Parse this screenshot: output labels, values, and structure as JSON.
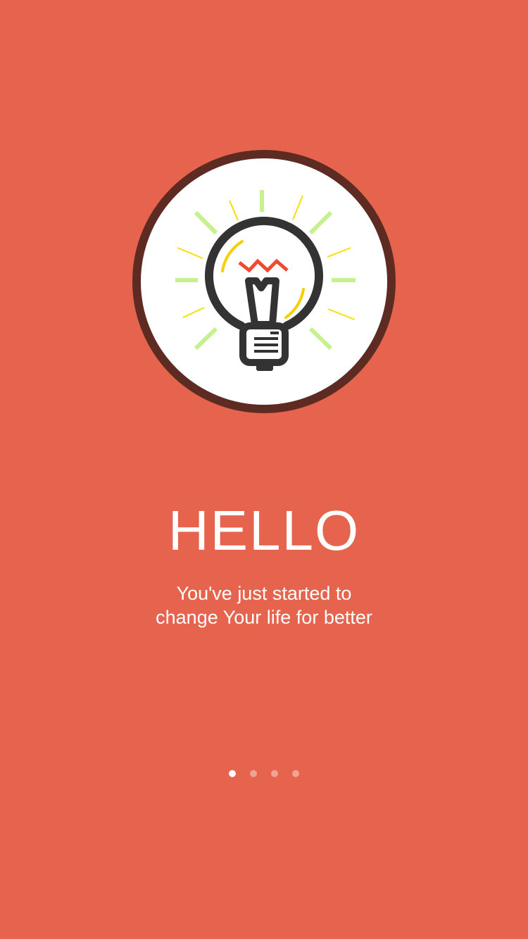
{
  "onboarding": {
    "title": "HELLO",
    "subtitle_line1": "You've just started to",
    "subtitle_line2": "change Your life for better",
    "illustration_icon": "lightbulb-icon",
    "pager": {
      "total_pages": 4,
      "current_page": 1
    }
  },
  "colors": {
    "background": "#E6644D",
    "circle_ring": "#5E2B23",
    "circle_fill": "#FFFFFF",
    "bulb_outline": "#333333",
    "filament": "#F04A32",
    "glow_yellow": "#F5D000",
    "rays_green": "#C7F08E",
    "rays_yellow": "#F5E000",
    "dot_active": "#FFFFFF",
    "dot_inactive": "rgba(255,255,255,0.4)"
  }
}
